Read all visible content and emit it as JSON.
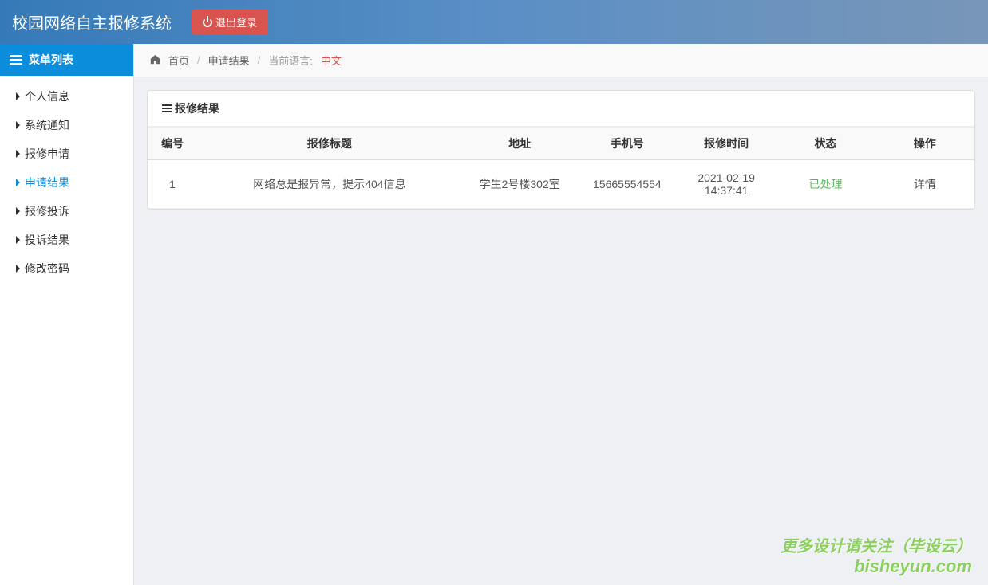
{
  "header": {
    "app_title": "校园网络自主报修系统",
    "logout_label": "退出登录"
  },
  "sidebar": {
    "header": "菜单列表",
    "items": [
      {
        "label": "个人信息"
      },
      {
        "label": "系统通知"
      },
      {
        "label": "报修申请"
      },
      {
        "label": "申请结果",
        "active": true
      },
      {
        "label": "报修投诉"
      },
      {
        "label": "投诉结果"
      },
      {
        "label": "修改密码"
      }
    ]
  },
  "breadcrumb": {
    "home": "首页",
    "current": "申请结果",
    "lang_label": "当前语言:",
    "lang_value": "中文"
  },
  "panel": {
    "title": "报修结果",
    "columns": [
      "编号",
      "报修标题",
      "地址",
      "手机号",
      "报修时间",
      "状态",
      "操作"
    ],
    "rows": [
      {
        "id": "1",
        "title": "网络总是报异常，提示404信息",
        "address": "学生2号楼302室",
        "phone": "15665554554",
        "time": "2021-02-19 14:37:41",
        "status": "已处理",
        "action": "详情"
      }
    ]
  },
  "watermark": {
    "line1": "更多设计请关注（毕设云）",
    "line2": "bisheyun.com"
  }
}
